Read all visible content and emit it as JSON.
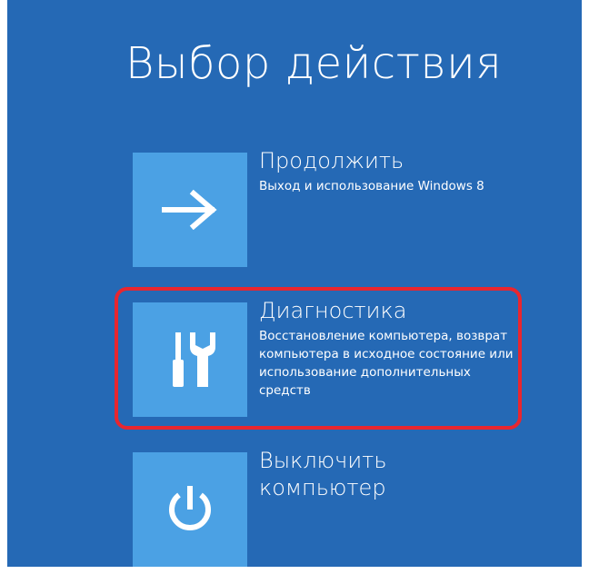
{
  "page": {
    "title": "Выбор действия"
  },
  "options": [
    {
      "title": "Продолжить",
      "description": "Выход и использование Windows 8",
      "icon": "arrow-right-icon"
    },
    {
      "title": "Диагностика",
      "description": "Восстановление компьютера, возврат компьютера в исходное состояние или использование дополнительных средств",
      "icon": "tools-icon",
      "highlighted": true
    },
    {
      "title": "Выключить компьютер",
      "description": "",
      "icon": "power-icon"
    }
  ],
  "colors": {
    "background": "#2569b5",
    "tile": "#4ba1e4",
    "highlight": "#e8262f",
    "text": "#ffffff"
  }
}
